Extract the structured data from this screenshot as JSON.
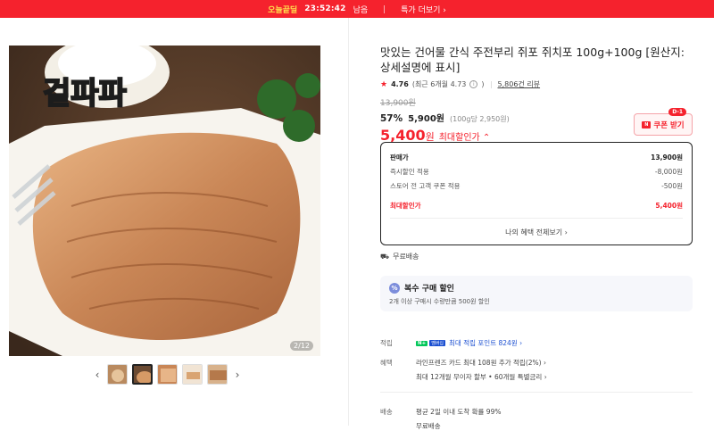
{
  "topbar": {
    "deal": "오늘끝딜",
    "time": "23:52:42",
    "time_suffix": "남음",
    "more": "특가 더보기 ›"
  },
  "gallery": {
    "logo_text": "겉파파",
    "counter": "2/12",
    "prev": "‹",
    "next": "›"
  },
  "product": {
    "title": "맛있는 건어물 간식 주전부리 쥐포 쥐치포 100g+100g [원산지: 상세설명에 표시]",
    "rating": "4.76",
    "recent_rating": "(최근 6개월 4.73",
    "info_mark": "i",
    "recent_close": ")",
    "reviews": "5,806건 리뷰",
    "original_price": "13,900원",
    "discount_rate": "57%",
    "sale_price": "5,900원",
    "per_unit": "(100g당 2,950원)",
    "max_price": "5,400",
    "max_price_unit": "원",
    "max_label": "최대할인가 ⌃",
    "coupon_tag": "D-1",
    "coupon_label": "쿠폰 받기"
  },
  "breakdown": {
    "rows": [
      {
        "label": "판매가",
        "value": "13,900원"
      },
      {
        "label": "즉시할인 적용",
        "value": "-8,000원"
      },
      {
        "label": "스토어 전 고객 쿠폰 적용",
        "value": "-500원"
      }
    ],
    "max_label": "최대할인가",
    "max_value": "5,400원",
    "benefit_link": "나의 혜택 전체보기 ›"
  },
  "shipping_free": "무료배송",
  "multi": {
    "title": "복수 구매 할인",
    "sub": "2개 이상 구매시 수량만큼 500원 할인"
  },
  "points": {
    "label": "적립",
    "badge_n": "N+",
    "badge_p": "멤버십",
    "text": "최대 적립 포인트 824원 ›"
  },
  "benefit": {
    "label": "혜택",
    "line1": "라인프렌즈 카드 최대 108원 추가 적립(2%) ›",
    "line2": "최대 12개월 무이자 할부 • 60개월 특별금리 ›"
  },
  "delivery": {
    "label": "배송",
    "line1": "평균 2일 이내 도착 확률 99%",
    "line2": "무료배송"
  },
  "colors": {
    "accent": "#f5222d",
    "link": "#1b4fd1",
    "npay": "#03c75a"
  }
}
